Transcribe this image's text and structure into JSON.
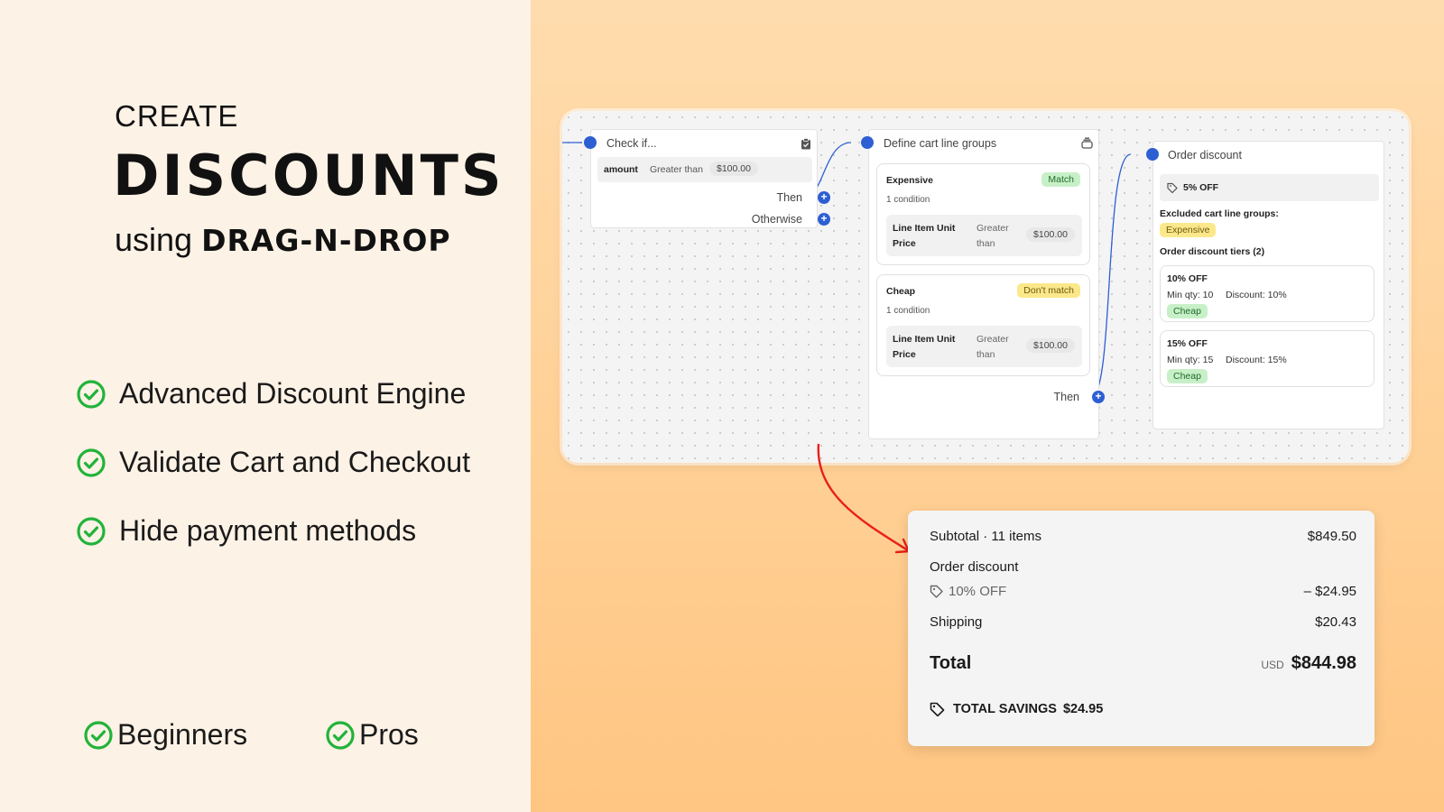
{
  "headline": {
    "create": "CREATE",
    "discounts": "DISCOUNTS",
    "using": "using",
    "method": "DRAG-N-DROP"
  },
  "features": [
    {
      "label": "Advanced Discount Engine",
      "icon": "check-circle-icon"
    },
    {
      "label": "Validate Cart and Checkout",
      "icon": "check-circle-icon"
    },
    {
      "label": "Hide payment methods",
      "icon": "check-circle-icon"
    }
  ],
  "audience": [
    {
      "label": "Beginners",
      "icon": "check-circle-icon"
    },
    {
      "label": "Pros",
      "icon": "check-circle-icon"
    }
  ],
  "flow": {
    "check_node": {
      "title": "Check if...",
      "condition_field": "amount",
      "condition_op": "Greater than",
      "condition_value": "$100.00",
      "then_label": "Then",
      "otherwise_label": "Otherwise"
    },
    "groups_node": {
      "title": "Define cart line groups",
      "groups": [
        {
          "name": "Expensive",
          "badge": "Match",
          "conditions": "1 condition",
          "field": "Line Item Unit Price",
          "op": "Greater than",
          "value": "$100.00"
        },
        {
          "name": "Cheap",
          "badge": "Don't match",
          "conditions": "1 condition",
          "field": "Line Item Unit Price",
          "op": "Greater than",
          "value": "$100.00"
        }
      ],
      "then_label": "Then"
    },
    "order_node": {
      "title": "Order discount",
      "discount_label": "5% OFF",
      "excluded_title": "Excluded cart line groups:",
      "excluded_badge": "Expensive",
      "tiers_title": "Order discount tiers (2)",
      "tiers": [
        {
          "title": "10% OFF",
          "min_qty": "Min qty: 10",
          "discount": "Discount: 10%",
          "badge": "Cheap"
        },
        {
          "title": "15% OFF",
          "min_qty": "Min qty: 15",
          "discount": "Discount: 15%",
          "badge": "Cheap"
        }
      ]
    }
  },
  "summary": {
    "subtotal_label": "Subtotal · 11 items",
    "subtotal_value": "$849.50",
    "order_discount_label": "Order discount",
    "discount_code": "10% OFF",
    "discount_value": "– $24.95",
    "shipping_label": "Shipping",
    "shipping_value": "$20.43",
    "total_label": "Total",
    "currency": "USD",
    "total_value": "$844.98",
    "savings_label": "TOTAL SAVINGS",
    "savings_value": "$24.95"
  },
  "colors": {
    "accent_blue": "#2d5fd3",
    "check_green": "#22b33a",
    "arrow_red": "#e8201a",
    "match_green": "#c8f0c8",
    "warn_yellow": "#fbe88a"
  }
}
